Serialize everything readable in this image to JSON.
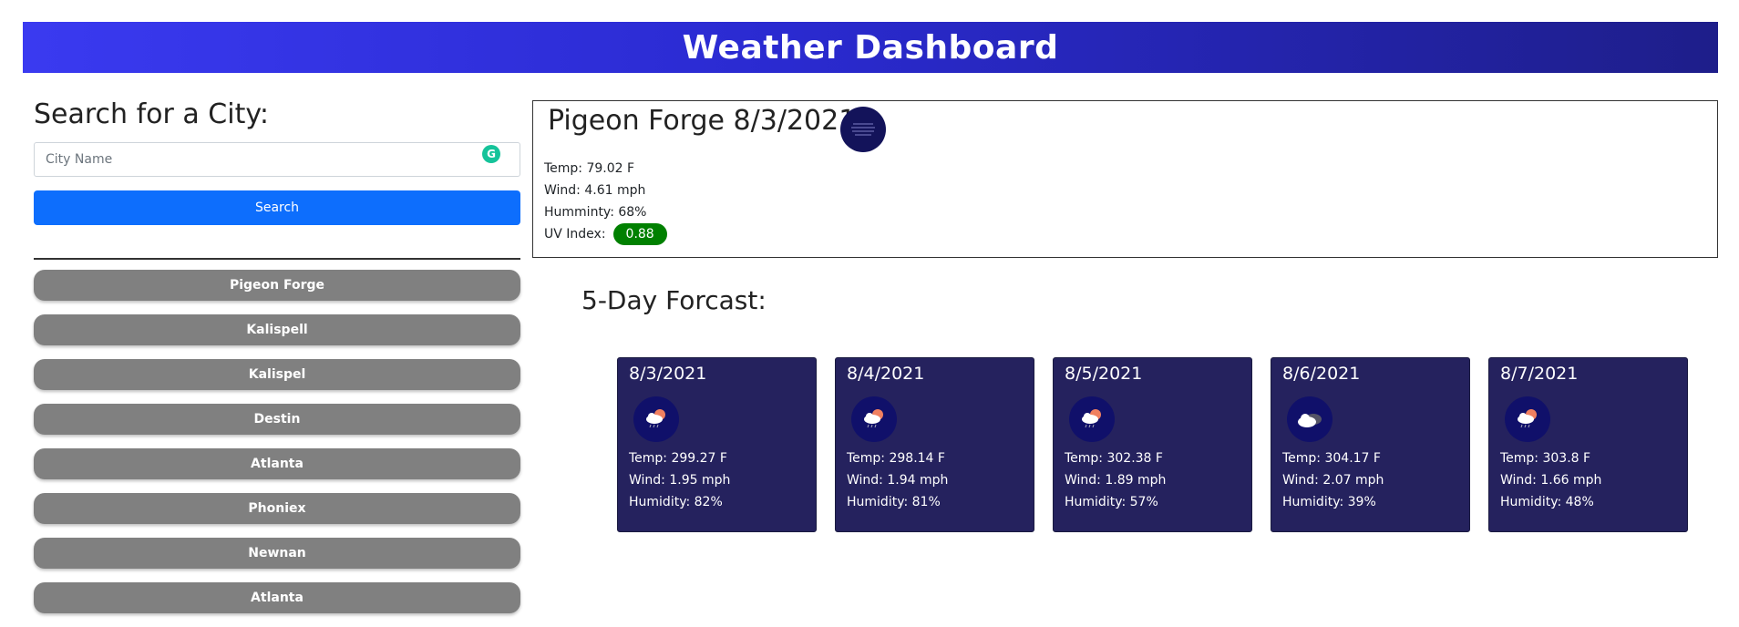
{
  "header": {
    "title": "Weather Dashboard"
  },
  "search": {
    "title": "Search for a City:",
    "placeholder": "City Name",
    "grammarly_badge": "G",
    "button_label": "Search"
  },
  "history": [
    "Pigeon Forge",
    "Kalispell",
    "Kalispel",
    "Destin",
    "Atlanta",
    "Phoniex",
    "Newnan",
    "Atlanta"
  ],
  "current": {
    "title": "Pigeon Forge 8/3/2021",
    "icon": "mist-icon",
    "temp": "Temp:  79.02 F",
    "wind": "Wind:  4.61 mph",
    "humidity": "Humminty:  68%",
    "uv_label": "UV Index:",
    "uv_value": "0.88",
    "uv_color": "#008000"
  },
  "forecast": {
    "title": "5-Day Forcast:",
    "days": [
      {
        "date": "8/3/2021",
        "icon": "rain-sun-icon",
        "temp": "Temp: 299.27 F",
        "wind": "Wind: 1.95 mph",
        "humidity": "Humidity: 82%"
      },
      {
        "date": "8/4/2021",
        "icon": "rain-sun-icon",
        "temp": "Temp: 298.14 F",
        "wind": "Wind: 1.94 mph",
        "humidity": "Humidity: 81%"
      },
      {
        "date": "8/5/2021",
        "icon": "rain-sun-icon",
        "temp": "Temp: 302.38 F",
        "wind": "Wind: 1.89 mph",
        "humidity": "Humidity: 57%"
      },
      {
        "date": "8/6/2021",
        "icon": "cloudy-icon",
        "temp": "Temp: 304.17 F",
        "wind": "Wind: 2.07 mph",
        "humidity": "Humidity: 39%"
      },
      {
        "date": "8/7/2021",
        "icon": "rain-sun-icon",
        "temp": "Temp: 303.8 F",
        "wind": "Wind: 1.66 mph",
        "humidity": "Humidity: 48%"
      }
    ]
  },
  "colors": {
    "header_gradient_start": "#3a3af0",
    "header_gradient_end": "#1e1e8a",
    "search_button": "#0d6efd",
    "history_button": "#808080",
    "forecast_card": "#25225e"
  }
}
